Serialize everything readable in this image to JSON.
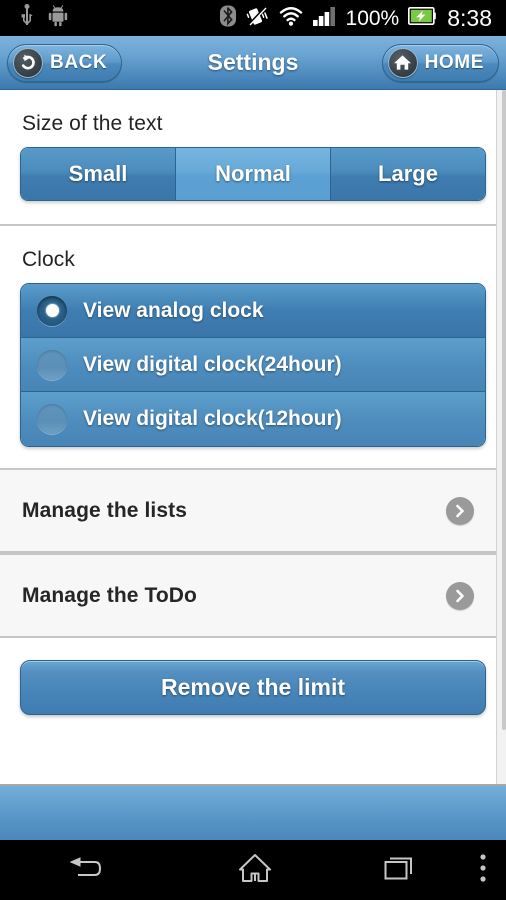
{
  "status_bar": {
    "left_icons": [
      "usb-icon",
      "android-robot-icon"
    ],
    "right_icons": [
      "bluetooth-icon",
      "vibrate-icon",
      "wifi-icon",
      "signal-icon",
      "battery-charging-icon"
    ],
    "battery_percent": "100%",
    "time": "8:38",
    "background": "#000000",
    "icon_color": "#ffffff"
  },
  "header": {
    "back_label": "BACK",
    "title": "Settings",
    "home_label": "HOME",
    "back_icon": "back-arrow-icon",
    "home_icon": "house-icon",
    "gradient_top": "#7db2dc",
    "gradient_bottom": "#3c79ae"
  },
  "text_size": {
    "label": "Size of the text",
    "options": [
      {
        "label": "Small",
        "selected": false
      },
      {
        "label": "Normal",
        "selected": true
      },
      {
        "label": "Large",
        "selected": false
      }
    ],
    "selected_color": "#67a9d8",
    "unselected_color": "#4b8cbd"
  },
  "clock": {
    "label": "Clock",
    "options": [
      {
        "label": "View analog clock",
        "selected": true
      },
      {
        "label": "View digital clock(24hour)",
        "selected": false
      },
      {
        "label": "View digital clock(12hour)",
        "selected": false
      }
    ]
  },
  "nav_rows": [
    {
      "label": "Manage the lists",
      "chevron": "chevron-right-icon"
    },
    {
      "label": "Manage the ToDo",
      "chevron": "chevron-right-icon"
    }
  ],
  "action": {
    "remove_limit_label": "Remove the limit",
    "color": "#4886ba"
  },
  "nav_bar": {
    "back": "back-icon",
    "home": "home-icon",
    "recents": "recents-icon",
    "overflow": "overflow-menu-icon"
  }
}
